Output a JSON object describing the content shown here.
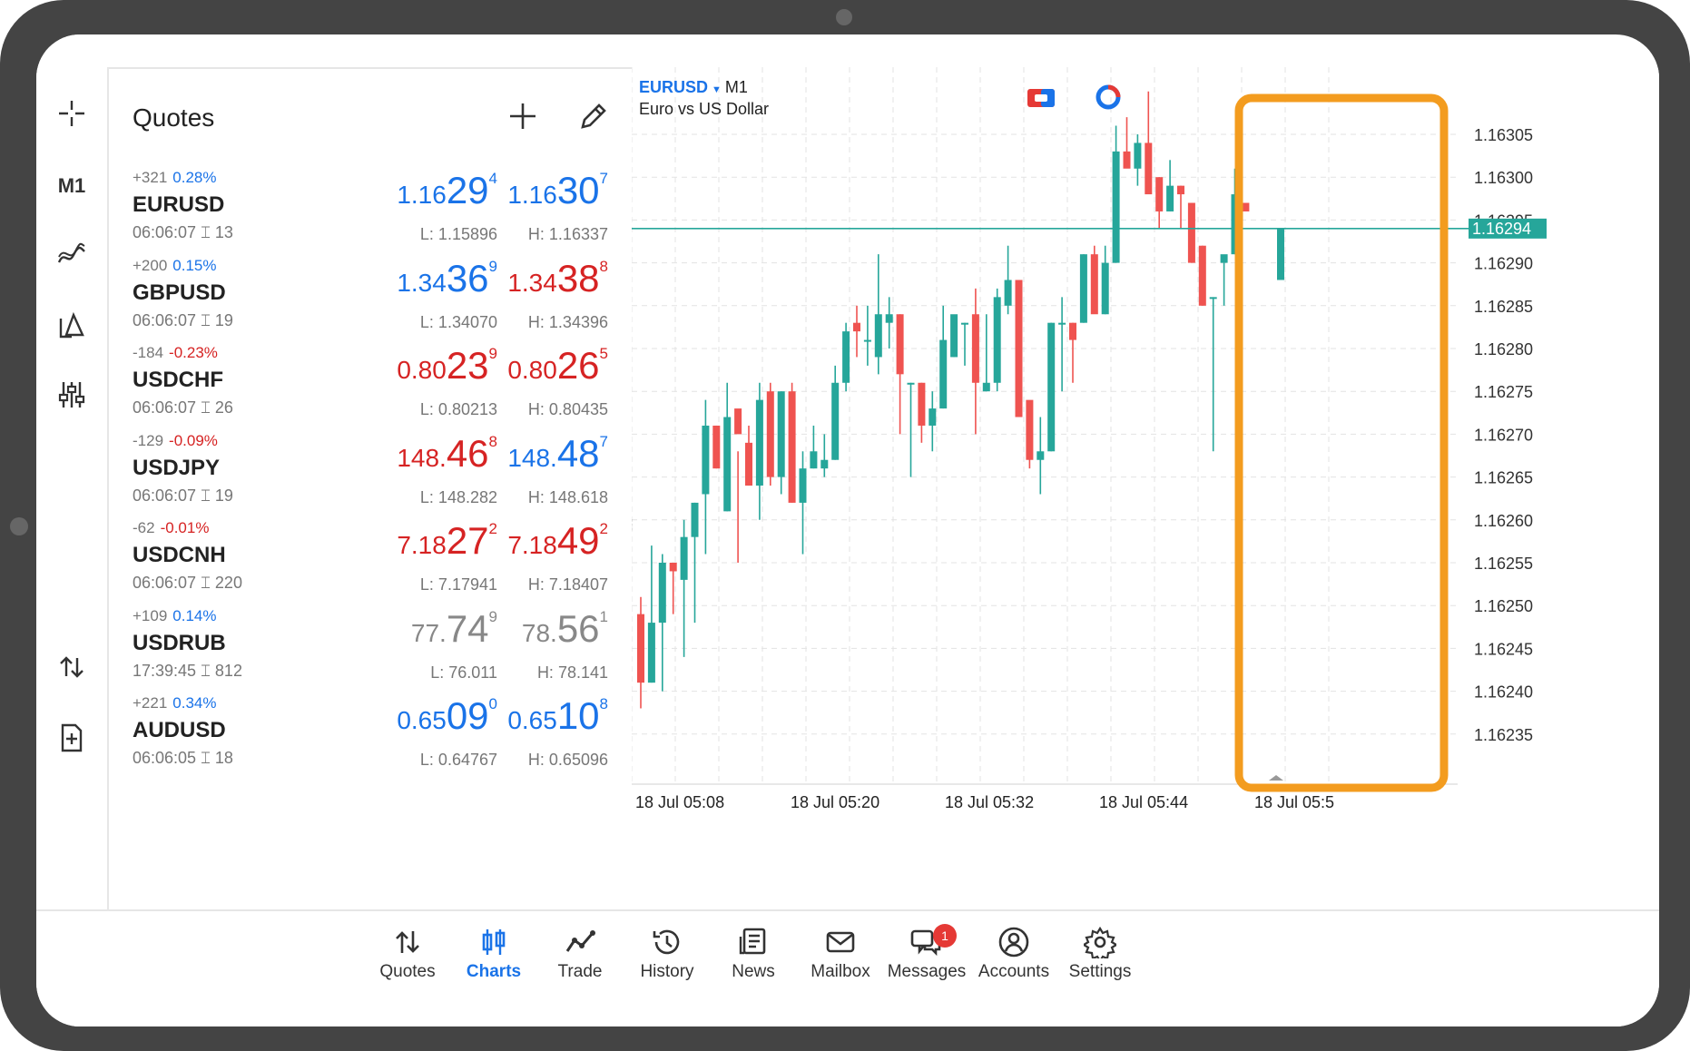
{
  "toolbar": {
    "timeframe": "M1"
  },
  "quotes": {
    "title": "Quotes",
    "rows": [
      {
        "change": "+321",
        "pct": "0.28%",
        "symbol": "EURUSD",
        "time": "06:06:07",
        "spread_icon": "spread-icon",
        "spread": "13",
        "bid_small": "1.16",
        "bid_big": "29",
        "bid_sup": "4",
        "ask_small": "1.16",
        "ask_big": "30",
        "ask_sup": "7",
        "low": "L: 1.15896",
        "high": "H: 1.16337",
        "dir": "up",
        "bid_color": "#1a73e8",
        "ask_color": "#1a73e8"
      },
      {
        "change": "+200",
        "pct": "0.15%",
        "symbol": "GBPUSD",
        "time": "06:06:07",
        "spread": "19",
        "bid_small": "1.34",
        "bid_big": "36",
        "bid_sup": "9",
        "ask_small": "1.34",
        "ask_big": "38",
        "ask_sup": "8",
        "low": "L: 1.34070",
        "high": "H: 1.34396",
        "dir": "up",
        "bid_color": "#1a73e8",
        "ask_color": "#d62323"
      },
      {
        "change": "-184",
        "pct": "-0.23%",
        "symbol": "USDCHF",
        "time": "06:06:07",
        "spread": "26",
        "bid_small": "0.80",
        "bid_big": "23",
        "bid_sup": "9",
        "ask_small": "0.80",
        "ask_big": "26",
        "ask_sup": "5",
        "low": "L: 0.80213",
        "high": "H: 0.80435",
        "dir": "down",
        "bid_color": "#d62323",
        "ask_color": "#d62323"
      },
      {
        "change": "-129",
        "pct": "-0.09%",
        "symbol": "USDJPY",
        "time": "06:06:07",
        "spread": "19",
        "bid_small": "148.",
        "bid_big": "46",
        "bid_sup": "8",
        "ask_small": "148.",
        "ask_big": "48",
        "ask_sup": "7",
        "low": "L: 148.282",
        "high": "H: 148.618",
        "dir": "down",
        "bid_color": "#d62323",
        "ask_color": "#1a73e8"
      },
      {
        "change": "-62",
        "pct": "-0.01%",
        "symbol": "USDCNH",
        "time": "06:06:07",
        "spread": "220",
        "bid_small": "7.18",
        "bid_big": "27",
        "bid_sup": "2",
        "ask_small": "7.18",
        "ask_big": "49",
        "ask_sup": "2",
        "low": "L: 7.17941",
        "high": "H: 7.18407",
        "dir": "down",
        "bid_color": "#d62323",
        "ask_color": "#d62323"
      },
      {
        "change": "+109",
        "pct": "0.14%",
        "symbol": "USDRUB",
        "time": "17:39:45",
        "spread": "812",
        "bid_small": "77.",
        "bid_big": "74",
        "bid_sup": "9",
        "ask_small": "78.",
        "ask_big": "56",
        "ask_sup": "1",
        "low": "L: 76.011",
        "high": "H: 78.141",
        "dir": "up",
        "bid_color": "#888888",
        "ask_color": "#888888"
      },
      {
        "change": "+221",
        "pct": "0.34%",
        "symbol": "AUDUSD",
        "time": "06:06:05",
        "spread": "18",
        "bid_small": "0.65",
        "bid_big": "09",
        "bid_sup": "0",
        "ask_small": "0.65",
        "ask_big": "10",
        "ask_sup": "8",
        "low": "L: 0.64767",
        "high": "H: 0.65096",
        "dir": "up",
        "bid_color": "#1a73e8",
        "ask_color": "#1a73e8"
      }
    ]
  },
  "chart": {
    "symbol": "EURUSD",
    "timeframe": "M1",
    "description": "Euro vs US Dollar",
    "price_labels": [
      "1.16305",
      "1.16300",
      "1.16295",
      "1.16290",
      "1.16285",
      "1.16280",
      "1.16275",
      "1.16270",
      "1.16265",
      "1.16260",
      "1.16255",
      "1.16250",
      "1.16245",
      "1.16240",
      "1.16235"
    ],
    "current_price": "1.16294",
    "time_labels": [
      "18 Jul 05:08",
      "18 Jul 05:20",
      "18 Jul 05:32",
      "18 Jul 05:44",
      "18 Jul 05:5"
    ],
    "bull_color": "#26a69a",
    "bear_color": "#ef5350",
    "highlight_color": "#f39c1f",
    "candles": [
      [
        1.16249,
        1.16251,
        1.16238,
        1.16241
      ],
      [
        1.16241,
        1.16257,
        1.16241,
        1.16248
      ],
      [
        1.16248,
        1.16256,
        1.1624,
        1.16255
      ],
      [
        1.16255,
        1.16255,
        1.16249,
        1.16254
      ],
      [
        1.16253,
        1.1626,
        1.16244,
        1.16258
      ],
      [
        1.16258,
        1.16262,
        1.16248,
        1.16262
      ],
      [
        1.16263,
        1.16274,
        1.16256,
        1.16271
      ],
      [
        1.16271,
        1.16271,
        1.16266,
        1.16266
      ],
      [
        1.16261,
        1.16276,
        1.16261,
        1.16272
      ],
      [
        1.16273,
        1.16268,
        1.16255,
        1.1627
      ],
      [
        1.16269,
        1.16271,
        1.16264,
        1.16264
      ],
      [
        1.16264,
        1.16276,
        1.1626,
        1.16274
      ],
      [
        1.16275,
        1.16276,
        1.16264,
        1.16265
      ],
      [
        1.16265,
        1.16275,
        1.16263,
        1.16275
      ],
      [
        1.16275,
        1.16276,
        1.16262,
        1.16262
      ],
      [
        1.16262,
        1.16268,
        1.16256,
        1.16266
      ],
      [
        1.16266,
        1.16271,
        1.16266,
        1.16268
      ],
      [
        1.16266,
        1.1627,
        1.16265,
        1.16267
      ],
      [
        1.16267,
        1.16278,
        1.16267,
        1.16276
      ],
      [
        1.16276,
        1.16283,
        1.16275,
        1.16282
      ],
      [
        1.16283,
        1.16285,
        1.16279,
        1.16282
      ],
      [
        1.16281,
        1.16285,
        1.16278,
        1.16281
      ],
      [
        1.16279,
        1.16291,
        1.16277,
        1.16284
      ],
      [
        1.16283,
        1.16286,
        1.1628,
        1.16284
      ],
      [
        1.16284,
        1.16284,
        1.1627,
        1.16277
      ],
      [
        1.16276,
        1.16276,
        1.16265,
        1.16276
      ],
      [
        1.16276,
        1.16276,
        1.16269,
        1.16271
      ],
      [
        1.16271,
        1.16275,
        1.16268,
        1.16273
      ],
      [
        1.16273,
        1.16285,
        1.16273,
        1.16281
      ],
      [
        1.16279,
        1.16281,
        1.16279,
        1.16284
      ],
      [
        1.16283,
        1.16283,
        1.16278,
        1.16283
      ],
      [
        1.16284,
        1.16287,
        1.1627,
        1.16276
      ],
      [
        1.16275,
        1.16284,
        1.16275,
        1.16276
      ],
      [
        1.16276,
        1.16287,
        1.16275,
        1.16286
      ],
      [
        1.16285,
        1.16292,
        1.16284,
        1.16288
      ],
      [
        1.16288,
        1.16288,
        1.16272,
        1.16272
      ],
      [
        1.16274,
        1.16272,
        1.16266,
        1.16267
      ],
      [
        1.16267,
        1.16272,
        1.16263,
        1.16268
      ],
      [
        1.16268,
        1.16283,
        1.16268,
        1.16283
      ],
      [
        1.16283,
        1.16286,
        1.16275,
        1.16283
      ],
      [
        1.16283,
        1.16283,
        1.16276,
        1.16281
      ],
      [
        1.16283,
        1.16291,
        1.16283,
        1.16291
      ],
      [
        1.16291,
        1.16292,
        1.16285,
        1.16284
      ],
      [
        1.16284,
        1.16292,
        1.16284,
        1.1629
      ],
      [
        1.1629,
        1.16306,
        1.1629,
        1.16303
      ],
      [
        1.16303,
        1.16307,
        1.16302,
        1.16301
      ],
      [
        1.16301,
        1.16305,
        1.16299,
        1.16304
      ],
      [
        1.16304,
        1.1631,
        1.16302,
        1.16298
      ],
      [
        1.163,
        1.163,
        1.16294,
        1.16296
      ],
      [
        1.16296,
        1.16302,
        1.16296,
        1.16299
      ],
      [
        1.16299,
        1.16299,
        1.16294,
        1.16298
      ],
      [
        1.16297,
        1.16297,
        1.1629,
        1.1629
      ],
      [
        1.16292,
        1.16292,
        1.16285,
        1.16285
      ],
      [
        1.16286,
        1.16286,
        1.16268,
        1.16286
      ],
      [
        1.1629,
        1.1629,
        1.16285,
        1.16291
      ],
      [
        1.16291,
        1.16301,
        1.16291,
        1.16298
      ],
      [
        1.16297,
        1.16294,
        1.16294,
        1.16296
      ]
    ],
    "last_candle": [
      1.16294,
      1.16294,
      1.16288,
      1.16288
    ]
  },
  "nav": {
    "items": [
      {
        "label": "Quotes",
        "icon": "quotes-arrows-icon"
      },
      {
        "label": "Charts",
        "icon": "charts-candles-icon"
      },
      {
        "label": "Trade",
        "icon": "trade-line-icon"
      },
      {
        "label": "History",
        "icon": "history-clock-icon"
      },
      {
        "label": "News",
        "icon": "news-doc-icon"
      },
      {
        "label": "Mailbox",
        "icon": "mailbox-envelope-icon"
      },
      {
        "label": "Messages",
        "icon": "messages-bubbles-icon"
      },
      {
        "label": "Accounts",
        "icon": "accounts-user-icon"
      },
      {
        "label": "Settings",
        "icon": "settings-gear-icon"
      }
    ],
    "messages_badge": "1",
    "active": "Charts"
  }
}
